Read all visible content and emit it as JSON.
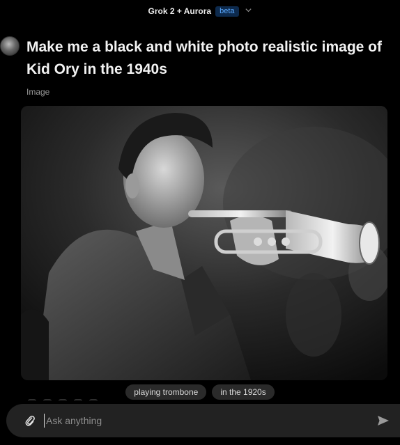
{
  "header": {
    "model_name": "Grok 2 + Aurora",
    "badge": "beta",
    "chevron_icon": "chevron-down-icon"
  },
  "message": {
    "prompt": "Make me a black and white photo realistic image of Kid Ory in the 1940s",
    "attachment_label": "Image"
  },
  "suggestions": [
    "playing trombone",
    "in the 1920s"
  ],
  "composer": {
    "placeholder": "Ask anything",
    "attach_icon": "paperclip-icon",
    "send_icon": "send-icon"
  },
  "colors": {
    "background": "#000000",
    "badge_bg": "#0d2a4d",
    "badge_text": "#5aa9ff",
    "chip_bg": "#2a2a2a",
    "input_bg": "#222222"
  }
}
